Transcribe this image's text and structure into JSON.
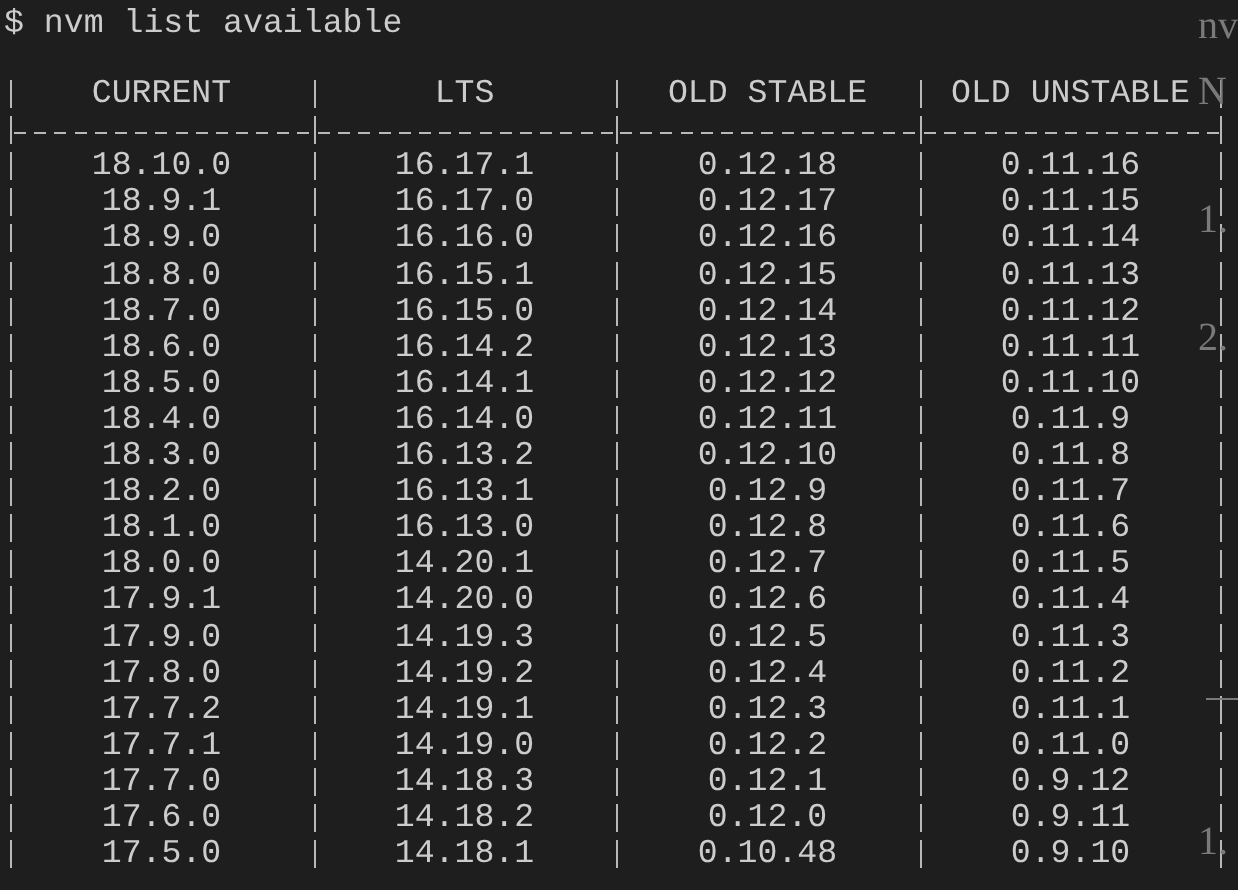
{
  "prompt": "$ nvm list available",
  "table": {
    "columns": [
      "CURRENT",
      "LTS",
      "OLD STABLE",
      "OLD UNSTABLE"
    ],
    "rows": [
      [
        "18.10.0",
        "16.17.1",
        "0.12.18",
        "0.11.16"
      ],
      [
        "18.9.1",
        "16.17.0",
        "0.12.17",
        "0.11.15"
      ],
      [
        "18.9.0",
        "16.16.0",
        "0.12.16",
        "0.11.14"
      ],
      [
        "18.8.0",
        "16.15.1",
        "0.12.15",
        "0.11.13"
      ],
      [
        "18.7.0",
        "16.15.0",
        "0.12.14",
        "0.11.12"
      ],
      [
        "18.6.0",
        "16.14.2",
        "0.12.13",
        "0.11.11"
      ],
      [
        "18.5.0",
        "16.14.1",
        "0.12.12",
        "0.11.10"
      ],
      [
        "18.4.0",
        "16.14.0",
        "0.12.11",
        "0.11.9"
      ],
      [
        "18.3.0",
        "16.13.2",
        "0.12.10",
        "0.11.8"
      ],
      [
        "18.2.0",
        "16.13.1",
        "0.12.9",
        "0.11.7"
      ],
      [
        "18.1.0",
        "16.13.0",
        "0.12.8",
        "0.11.6"
      ],
      [
        "18.0.0",
        "14.20.1",
        "0.12.7",
        "0.11.5"
      ],
      [
        "17.9.1",
        "14.20.0",
        "0.12.6",
        "0.11.4"
      ],
      [
        "17.9.0",
        "14.19.3",
        "0.12.5",
        "0.11.3"
      ],
      [
        "17.8.0",
        "14.19.2",
        "0.12.4",
        "0.11.2"
      ],
      [
        "17.7.2",
        "14.19.1",
        "0.12.3",
        "0.11.1"
      ],
      [
        "17.7.1",
        "14.19.0",
        "0.12.2",
        "0.11.0"
      ],
      [
        "17.7.0",
        "14.18.3",
        "0.12.1",
        "0.9.12"
      ],
      [
        "17.6.0",
        "14.18.2",
        "0.12.0",
        "0.9.11"
      ],
      [
        "17.5.0",
        "14.18.1",
        "0.10.48",
        "0.9.10"
      ]
    ]
  },
  "background_text": [
    "nv",
    "N",
    "1.",
    "2.",
    "1."
  ]
}
